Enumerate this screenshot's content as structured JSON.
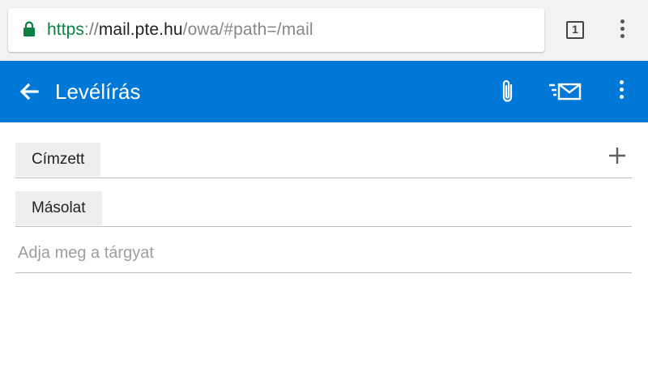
{
  "browser": {
    "url_scheme": "https",
    "url_sep": "://",
    "url_host": "mail.pte.hu",
    "url_path": "/owa/#path=/mail",
    "tab_count": "1",
    "icons": {
      "lock": "lock-icon",
      "menu": "more-vert-icon",
      "tabs": "tab-switcher-icon"
    },
    "colors": {
      "secure": "#0b8043"
    }
  },
  "header": {
    "title": "Levélírás",
    "icons": {
      "back": "arrow-back-icon",
      "attach": "paperclip-icon",
      "send": "send-mail-icon",
      "menu": "more-vert-icon"
    },
    "colors": {
      "accent": "#0078d7"
    }
  },
  "compose": {
    "to_label": "Címzett",
    "cc_label": "Másolat",
    "subject_placeholder": "Adja meg a tárgyat",
    "subject_value": "",
    "add_icon": "plus-icon"
  }
}
